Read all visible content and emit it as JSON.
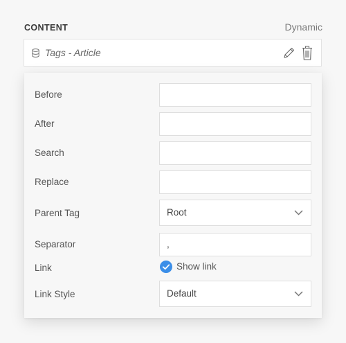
{
  "section": {
    "title": "CONTENT",
    "mode": "Dynamic"
  },
  "source": {
    "label": "Tags - Article"
  },
  "fields": {
    "before": {
      "label": "Before",
      "value": ""
    },
    "after": {
      "label": "After",
      "value": ""
    },
    "search": {
      "label": "Search",
      "value": ""
    },
    "replace": {
      "label": "Replace",
      "value": ""
    },
    "parent_tag": {
      "label": "Parent Tag",
      "value": "Root"
    },
    "separator": {
      "label": "Separator",
      "value": ","
    },
    "link": {
      "label": "Link",
      "checkbox_label": "Show link",
      "checked": true
    },
    "link_style": {
      "label": "Link Style",
      "value": "Default"
    }
  },
  "colors": {
    "accent": "#3b8ee8",
    "background": "#f7f7f7",
    "field_border": "#dedede"
  },
  "icons": [
    "database-icon",
    "pencil-icon",
    "trash-icon",
    "chevron-down-icon",
    "checkmark-icon"
  ]
}
